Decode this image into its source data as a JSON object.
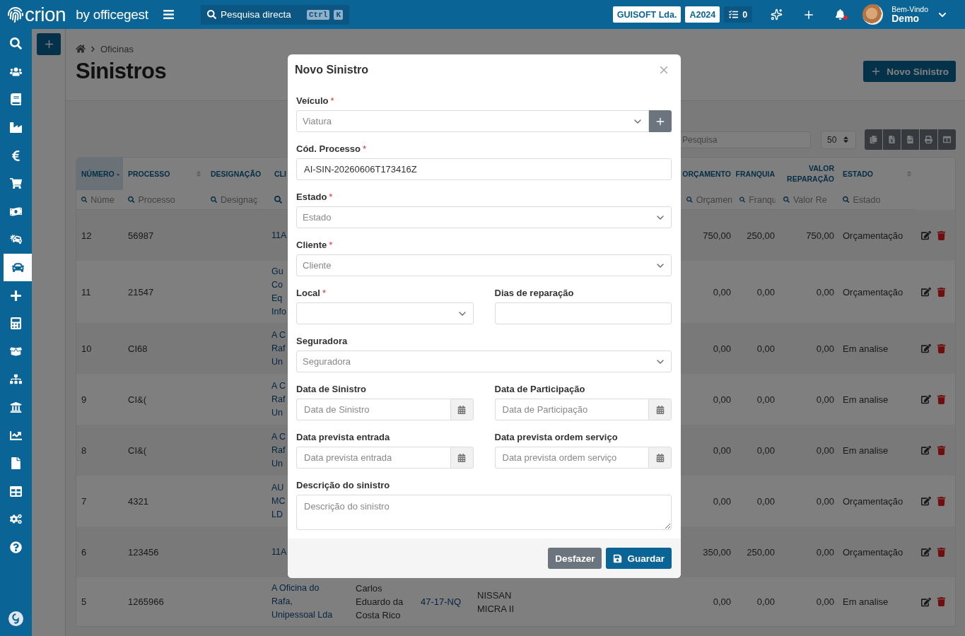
{
  "topbar": {
    "brand": "crion",
    "brand_suffix": "by officegest",
    "search": {
      "label": "Pesquisa directa",
      "keys": [
        "Ctrl",
        "K"
      ]
    },
    "company": "GUISOFT Lda.",
    "year": "A2024",
    "tasks": "0",
    "notifications_unread": true,
    "greeting": "Bem-Vindo",
    "user": "Demo"
  },
  "sidebar": {
    "items": [
      {
        "selected": false
      },
      {
        "selected": false
      },
      {
        "selected": false
      },
      {
        "selected": false
      },
      {
        "selected": false
      },
      {
        "selected": false
      },
      {
        "selected": false
      },
      {
        "selected": false
      },
      {
        "selected": true
      },
      {
        "selected": false
      },
      {
        "selected": false
      },
      {
        "selected": false
      },
      {
        "selected": false
      },
      {
        "selected": false
      },
      {
        "selected": false
      },
      {
        "selected": false
      },
      {
        "selected": false
      },
      {
        "selected": false
      },
      {
        "selected": false
      }
    ]
  },
  "page": {
    "breadcrumb": [
      "Oficinas"
    ],
    "title": "Sinistros",
    "new_button": "Novo Sinistro"
  },
  "toolbar": {
    "search_placeholder": "Pesquisa",
    "page_size": "50"
  },
  "table": {
    "columns": [
      {
        "label": "NÚMERO",
        "sorted": true,
        "filter_placeholder": "Núme"
      },
      {
        "label": "PROCESSO",
        "sorted": false,
        "filter_placeholder": "Processo"
      },
      {
        "label": "DESIGNAÇÃO",
        "sorted": false,
        "filter_placeholder": "Designaç"
      },
      {
        "label": "CLI",
        "sorted": false
      },
      {
        "label": "ORÇAMENTO",
        "sorted": false,
        "filter_placeholder": "Orçamen"
      },
      {
        "label": "FRANQUIA",
        "sorted": false,
        "filter_placeholder": "Franqu"
      },
      {
        "label": "VALOR REPARAÇÃO",
        "sorted": false,
        "filter_placeholder": "Valor Re"
      },
      {
        "label": "ESTADO",
        "sorted": false,
        "filter_placeholder": "Estado"
      }
    ],
    "rows": [
      {
        "number": "12",
        "process": "56987",
        "client": [
          "11A"
        ],
        "budget": "750,00",
        "deductible": "250,00",
        "repair_value": "750,00",
        "status": "Orçamentação"
      },
      {
        "number": "11",
        "process": "21547",
        "client": [
          "Gu",
          "Co",
          "Eq",
          "Info"
        ],
        "budget": "0,00",
        "deductible": "0,00",
        "repair_value": "0,00",
        "status": "Orçamentação"
      },
      {
        "number": "10",
        "process": "CI68",
        "client": [
          "A C",
          "Raf",
          "Un"
        ],
        "budget": "0,00",
        "deductible": "0,00",
        "repair_value": "0,00",
        "status": "Em analise"
      },
      {
        "number": "9",
        "process": "CI&(",
        "client": [
          "A C",
          "Raf",
          "Un"
        ],
        "budget": "0,00",
        "deductible": "0,00",
        "repair_value": "0,00",
        "status": "Em analise"
      },
      {
        "number": "8",
        "process": "CI&(",
        "client": [
          "A C",
          "Raf",
          "Un"
        ],
        "budget": "0,00",
        "deductible": "0,00",
        "repair_value": "0,00",
        "status": "Em analise"
      },
      {
        "number": "7",
        "process": "4321",
        "client": [
          "AU",
          "MC",
          "LD"
        ],
        "budget": "0,00",
        "deductible": "0,00",
        "repair_value": "0,00",
        "status": "Orçamentação"
      },
      {
        "number": "6",
        "process": "123456",
        "client": [
          "11A"
        ],
        "budget": "350,00",
        "deductible": "250,00",
        "repair_value": "0,00",
        "status": "Orçamentação"
      },
      {
        "number": "5",
        "process": "1265966",
        "client": [
          "A Oficina do",
          "Rafa,",
          "Unipessoal Lda"
        ],
        "holder": [
          "Carlos",
          "Eduardo da",
          "Costa Rico"
        ],
        "plate": "47-17-NQ",
        "vehicle": [
          "NISSAN",
          "MICRA II"
        ],
        "budget": "0,00",
        "deductible": "0,00",
        "repair_value": "0,00",
        "status": "Em analise"
      }
    ]
  },
  "modal": {
    "title": "Novo Sinistro",
    "rows": [
      [
        {
          "kind": "select",
          "label": "Veículo",
          "required_mark": "*",
          "placeholder": "Viatura",
          "add_button": true
        }
      ],
      [
        {
          "kind": "input",
          "label": "Cód. Processo",
          "required_mark": "*",
          "value": "AI-SIN-20260606T173416Z"
        }
      ],
      [
        {
          "kind": "select",
          "label": "Estado",
          "required_mark": "*",
          "placeholder": "Estado"
        }
      ],
      [
        {
          "kind": "select",
          "label": "Cliente",
          "required_mark": "*",
          "placeholder": "Cliente"
        }
      ],
      [
        {
          "kind": "select",
          "label": "Local",
          "required_mark": "*"
        },
        {
          "kind": "input",
          "label": "Dias de reparação"
        }
      ],
      [
        {
          "kind": "select",
          "label": "Seguradora",
          "placeholder": "Seguradora"
        }
      ],
      [
        {
          "kind": "date",
          "label": "Data de Sinistro",
          "placeholder": "Data de Sinistro"
        },
        {
          "kind": "date",
          "label": "Data de Participação",
          "placeholder": "Data de Participação"
        }
      ],
      [
        {
          "kind": "date",
          "label": "Data prevista entrada",
          "placeholder": "Data prevista entrada"
        },
        {
          "kind": "date",
          "label": "Data prevista ordem serviço",
          "placeholder": "Data prevista ordem serviço"
        }
      ],
      [
        {
          "kind": "textarea",
          "label": "Descrição do sinistro",
          "placeholder": "Descrição do sinistro"
        }
      ]
    ],
    "buttons": [
      {
        "kind": "secondary",
        "label": "Desfazer"
      },
      {
        "kind": "primary",
        "label": "Guardar"
      }
    ]
  }
}
